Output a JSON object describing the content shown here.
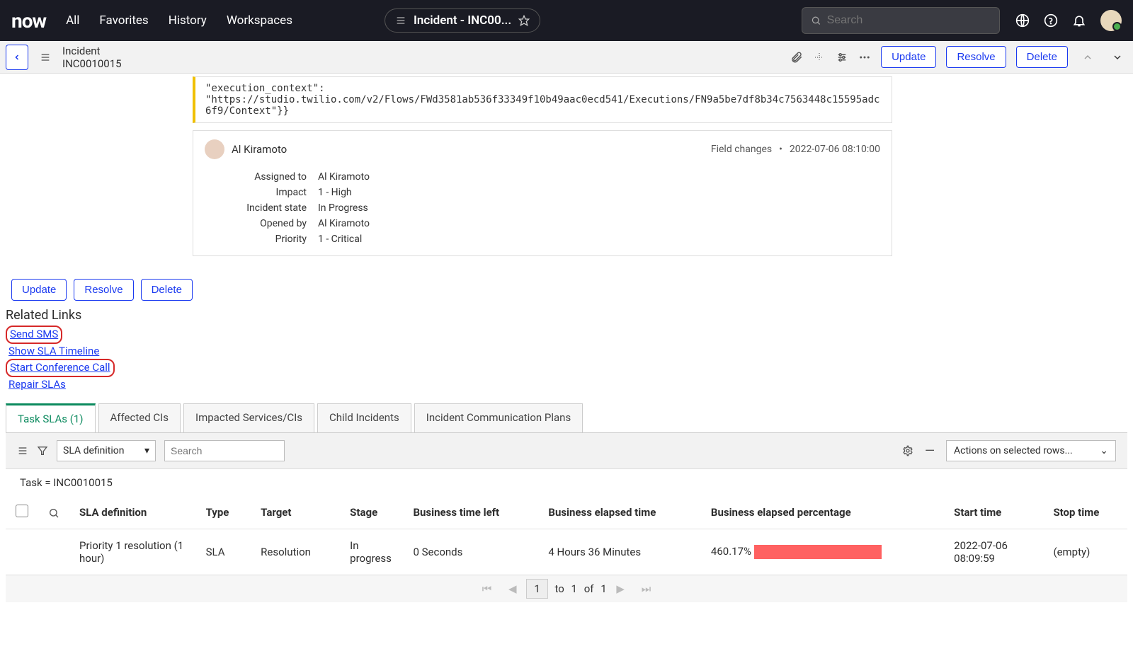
{
  "brand": "now",
  "topnav": [
    "All",
    "Favorites",
    "History",
    "Workspaces"
  ],
  "tab_chip": "Incident - INC00...",
  "search_placeholder": "Search",
  "subheader": {
    "line1": "Incident",
    "line2": "INC0010015",
    "buttons": {
      "update": "Update",
      "resolve": "Resolve",
      "delete": "Delete"
    }
  },
  "code_block": {
    "l1": "\"execution_context\":",
    "l2": "\"https://studio.twilio.com/v2/Flows/FWd3581ab536f33349f10b49aac0ecd541/Executions/FN9a5be7df8b34c7563448c15595adc6f9/Context\"}}"
  },
  "comment": {
    "author": "Al Kiramoto",
    "meta_label": "Field changes",
    "meta_time": "2022-07-06 08:10:00",
    "fields": [
      {
        "label": "Assigned to",
        "value": "Al Kiramoto"
      },
      {
        "label": "Impact",
        "value": "1 - High"
      },
      {
        "label": "Incident state",
        "value": "In Progress"
      },
      {
        "label": "Opened by",
        "value": "Al Kiramoto"
      },
      {
        "label": "Priority",
        "value": "1 - Critical"
      }
    ]
  },
  "form_buttons": {
    "update": "Update",
    "resolve": "Resolve",
    "delete": "Delete"
  },
  "related_title": "Related Links",
  "related_links": {
    "send_sms": "Send SMS",
    "show_sla": "Show SLA Timeline",
    "start_conf": "Start Conference Call",
    "repair": "Repair SLAs"
  },
  "tabs": {
    "active": "Task SLAs (1)",
    "others": [
      "Affected CIs",
      "Impacted Services/CIs",
      "Child Incidents",
      "Incident Communication Plans"
    ]
  },
  "listbar": {
    "search_field": "SLA definition",
    "search_placeholder": "Search",
    "actions": "Actions on selected rows..."
  },
  "breadcrumb": "Task = INC0010015",
  "columns": [
    "SLA definition",
    "Type",
    "Target",
    "Stage",
    "Business time left",
    "Business elapsed time",
    "Business elapsed percentage",
    "Start time",
    "Stop time"
  ],
  "row": {
    "sla_def": "Priority 1 resolution (1 hour)",
    "type": "SLA",
    "target": "Resolution",
    "stage": "In progress",
    "time_left": "0 Seconds",
    "elapsed": "4 Hours 36 Minutes",
    "pct": "460.17%",
    "start": "2022-07-06 08:09:59",
    "stop": "(empty)"
  },
  "pagination": {
    "from": "1",
    "to_word": "to",
    "to": "1",
    "of_word": "of",
    "total": "1"
  }
}
